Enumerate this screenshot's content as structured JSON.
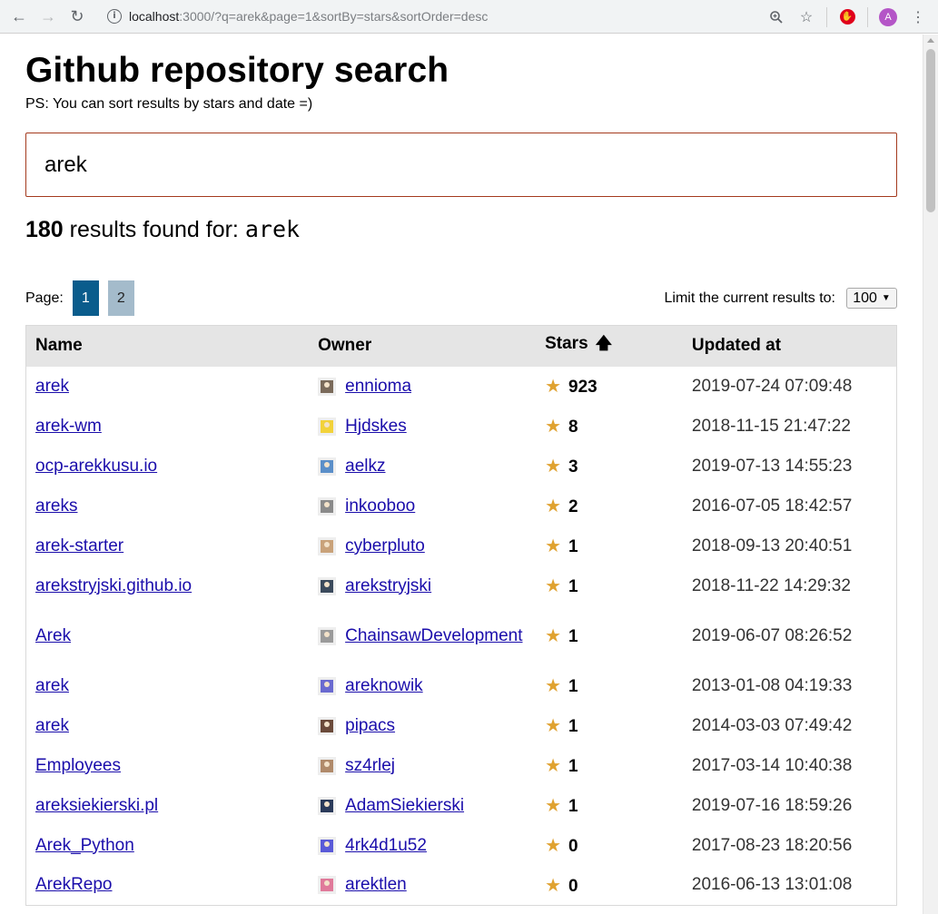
{
  "browser": {
    "url_host": "localhost",
    "url_rest": ":3000/?q=arek&page=1&sortBy=stars&sortOrder=desc",
    "profile_initial": "A"
  },
  "header": {
    "title": "Github repository search",
    "subtitle": "PS: You can sort results by stars and date =)"
  },
  "search": {
    "value": "arek"
  },
  "results": {
    "count": "180",
    "text": "results found for:",
    "query": "arek"
  },
  "pagination": {
    "label": "Page:",
    "pages": [
      "1",
      "2"
    ],
    "active": "1"
  },
  "limit": {
    "label": "Limit the current results to:",
    "value": "100"
  },
  "table": {
    "headers": {
      "name": "Name",
      "owner": "Owner",
      "stars": "Stars",
      "updated": "Updated at"
    },
    "rows": [
      {
        "name": "arek",
        "owner": "ennioma",
        "stars": "923",
        "updated": "2019-07-24 07:09:48",
        "avatar_color": "#7a6a5a"
      },
      {
        "name": "arek-wm",
        "owner": "Hjdskes",
        "stars": "8",
        "updated": "2018-11-15 21:47:22",
        "avatar_color": "#f2d23a"
      },
      {
        "name": "ocp-arekkusu.io",
        "owner": "aelkz",
        "stars": "3",
        "updated": "2019-07-13 14:55:23",
        "avatar_color": "#5b8fc9"
      },
      {
        "name": "areks",
        "owner": "inkooboo",
        "stars": "2",
        "updated": "2016-07-05 18:42:57",
        "avatar_color": "#8a8a8a"
      },
      {
        "name": "arek-starter",
        "owner": "cyberpluto",
        "stars": "1",
        "updated": "2018-09-13 20:40:51",
        "avatar_color": "#c9a27a"
      },
      {
        "name": "arekstryjski.github.io",
        "owner": "arekstryjski",
        "stars": "1",
        "updated": "2018-11-22 14:29:32",
        "avatar_color": "#3b4a5c"
      },
      {
        "name": "Arek",
        "owner": "ChainsawDevelopment",
        "stars": "1",
        "updated": "2019-06-07 08:26:52",
        "avatar_color": "#9a9a9a"
      },
      {
        "name": "arek",
        "owner": "areknowik",
        "stars": "1",
        "updated": "2013-01-08 04:19:33",
        "avatar_color": "#6a6ad0"
      },
      {
        "name": "arek",
        "owner": "pipacs",
        "stars": "1",
        "updated": "2014-03-03 07:49:42",
        "avatar_color": "#6b4a3a"
      },
      {
        "name": "Employees",
        "owner": "sz4rlej",
        "stars": "1",
        "updated": "2017-03-14 10:40:38",
        "avatar_color": "#b08a6a"
      },
      {
        "name": "areksiekierski.pl",
        "owner": "AdamSiekierski",
        "stars": "1",
        "updated": "2019-07-16 18:59:26",
        "avatar_color": "#2a3a5a"
      },
      {
        "name": "Arek_Python",
        "owner": "4rk4d1u52",
        "stars": "0",
        "updated": "2017-08-23 18:20:56",
        "avatar_color": "#5a5ad8"
      },
      {
        "name": "ArekRepo",
        "owner": "arektlen",
        "stars": "0",
        "updated": "2016-06-13 13:01:08",
        "avatar_color": "#e07a9a"
      }
    ]
  },
  "colors": {
    "accent_border": "#a43a1e",
    "page_active": "#0a5c8c",
    "page_inactive": "#a4bbcb",
    "link": "#1a0dab",
    "star": "#e0a230"
  }
}
